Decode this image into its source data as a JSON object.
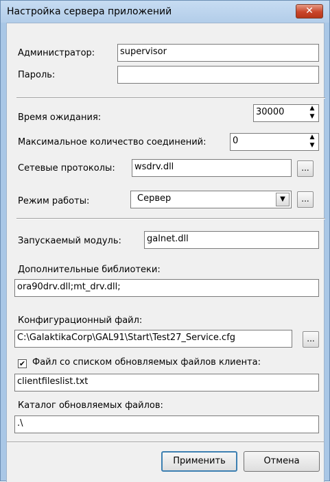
{
  "window": {
    "title": "Настройка сервера приложений",
    "close_symbol": "✕"
  },
  "admin": {
    "label": "Администратор:",
    "value": "supervisor"
  },
  "password": {
    "label": "Пароль:",
    "value": ""
  },
  "timeout": {
    "label": "Время ожидания:",
    "value": "30000"
  },
  "max_connections": {
    "label": "Максимальное количество соединений:",
    "value": "0"
  },
  "protocols": {
    "label": "Сетевые протоколы:",
    "value": "wsdrv.dll"
  },
  "mode": {
    "label": "Режим работы:",
    "value": "Сервер"
  },
  "module": {
    "label": "Запускаемый модуль:",
    "value": "galnet.dll"
  },
  "libraries": {
    "label": "Дополнительные библиотеки:",
    "value": "ora90drv.dll;mt_drv.dll;"
  },
  "config": {
    "label": "Конфигурационный файл:",
    "value": "C:\\GalaktikaCorp\\GAL91\\Start\\Test27_Service.cfg"
  },
  "client_files": {
    "label": "Файл  со списком  обновляемых файлов клиента:",
    "checked": true,
    "check_mark": "✔",
    "value": "clientfileslist.txt"
  },
  "catalog": {
    "label": "Каталог обновляемых файлов:",
    "value": ".\\"
  },
  "browse_label": "...",
  "spin_up": "▲",
  "spin_down": "▼",
  "dropdown_arrow": "▼",
  "buttons": {
    "apply": "Применить",
    "cancel": "Отмена"
  }
}
